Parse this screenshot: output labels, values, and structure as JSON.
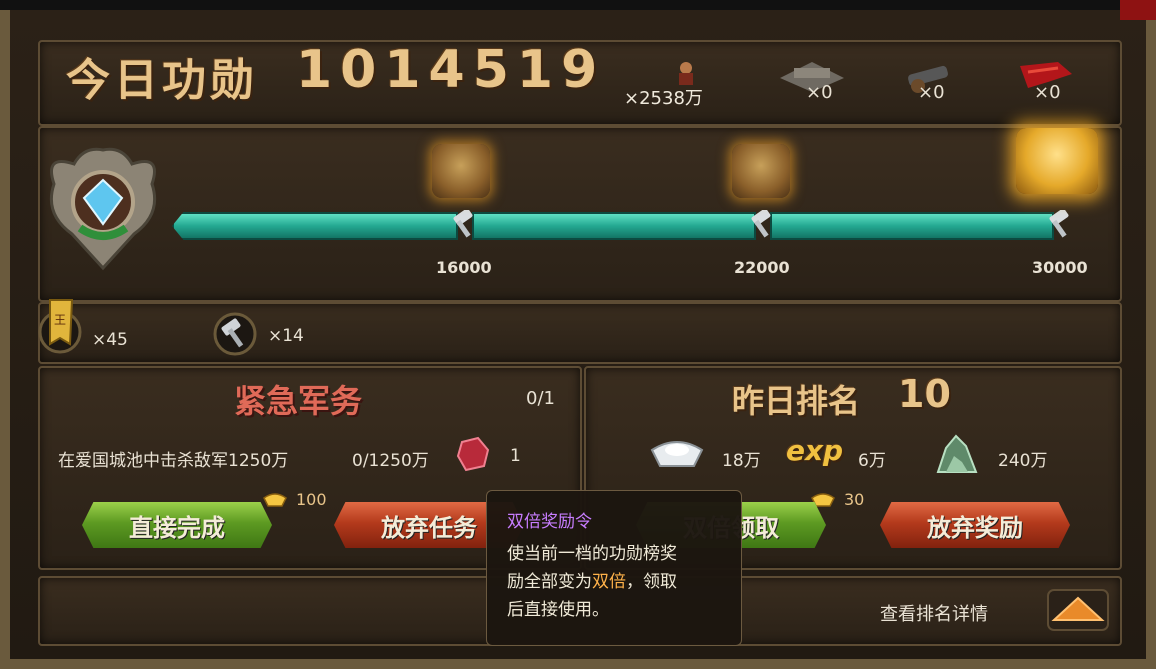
{
  "header": {
    "title": "今日功勋",
    "score": "1014519",
    "resources": [
      {
        "icon": "soldier-icon",
        "count": "×2538万"
      },
      {
        "icon": "city-icon",
        "count": "×0"
      },
      {
        "icon": "cannon-icon",
        "count": "×0"
      },
      {
        "icon": "flag-icon",
        "count": "×0"
      }
    ]
  },
  "progress": {
    "current": 1014519,
    "milestones": [
      "16000",
      "22000",
      "30000"
    ]
  },
  "inventory": {
    "king_token": "×45",
    "hammer": "×14"
  },
  "urgent_task": {
    "title": "紧急军务",
    "count": "0/1",
    "desc": "在爱国城池中击杀敌军1250万",
    "progress": "0/1250万",
    "reward_count": "1",
    "complete_cost": "100",
    "complete_label": "直接完成",
    "abandon_label": "放弃任务"
  },
  "yesterday_rank": {
    "title": "昨日排名",
    "rank": "10",
    "rewards": [
      {
        "icon": "silver-ingot-icon",
        "value": "18万"
      },
      {
        "icon": "exp-icon",
        "label": "exp",
        "value": "6万"
      },
      {
        "icon": "ore-icon",
        "value": "240万"
      }
    ],
    "double_cost": "30",
    "double_label": "双倍领取",
    "abandon_label": "放弃奖励"
  },
  "footer": {
    "view_details": "查看排名详情"
  },
  "tooltip": {
    "title": "双倍奖励令",
    "line1": "使当前一档的功勋榜奖",
    "line2_a": "励全部变为",
    "line2_hl": "双倍",
    "line2_b": "，领取",
    "line3": "后直接使用。"
  },
  "colors": {
    "gold_text": "#e8c48a",
    "bar_teal": "#24a891",
    "tooltip_title": "#c77dff",
    "tooltip_highlight": "#ffb24a"
  }
}
